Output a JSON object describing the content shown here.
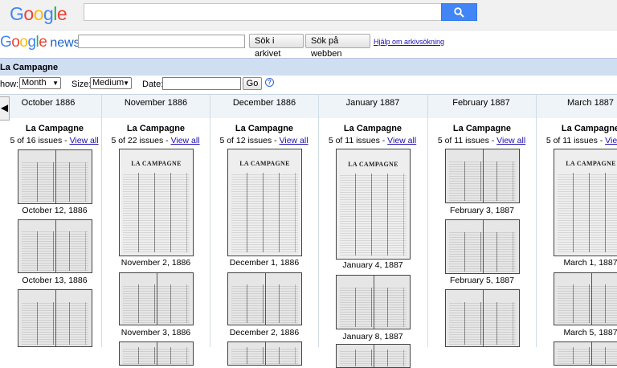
{
  "header": {
    "logo_text": "Google",
    "search_icon": "search-icon"
  },
  "newsbar": {
    "logo_google": "Google",
    "logo_news": "news",
    "archive_button": "Sök i arkivet",
    "web_button": "Sök på webben",
    "help_link": "Hjälp om arkivsökning"
  },
  "title": "La Campagne",
  "controls": {
    "show_label": "how:",
    "show_value": "Month",
    "size_label": "Size:",
    "size_value": "Medium",
    "date_label": "Date:",
    "go_label": "Go",
    "help_icon": "?"
  },
  "prev_arrow": "◀",
  "months": [
    {
      "label": "October 1886",
      "title": "La Campagne",
      "issues": "5 of 16 issues - ",
      "view_all": "View all",
      "dates": [
        "October 12, 1886",
        "October 13, 1886"
      ]
    },
    {
      "label": "November 1886",
      "title": "La Campagne",
      "issues": "5 of 22 issues - ",
      "view_all": "View all",
      "dates": [
        "November 2, 1886",
        "November 3, 1886"
      ]
    },
    {
      "label": "December 1886",
      "title": "La Campagne",
      "issues": "5 of 12 issues - ",
      "view_all": "View all",
      "dates": [
        "December 1, 1886",
        "December 2, 1886"
      ]
    },
    {
      "label": "January 1887",
      "title": "La Campagne",
      "issues": "5 of 11 issues - ",
      "view_all": "View all",
      "dates": [
        "January 4, 1887",
        "January 8, 1887"
      ]
    },
    {
      "label": "February 1887",
      "title": "La Campagne",
      "issues": "5 of 11 issues - ",
      "view_all": "View all",
      "dates": [
        "February 3, 1887",
        "February 5, 1887"
      ]
    },
    {
      "label": "March 1887",
      "title": "La Campagne",
      "issues": "5 of 11 issues - ",
      "view_all": "View all",
      "dates": [
        "March 1, 1887",
        "March 5, 1887"
      ]
    }
  ],
  "masthead": "LA CAMPAGNE"
}
